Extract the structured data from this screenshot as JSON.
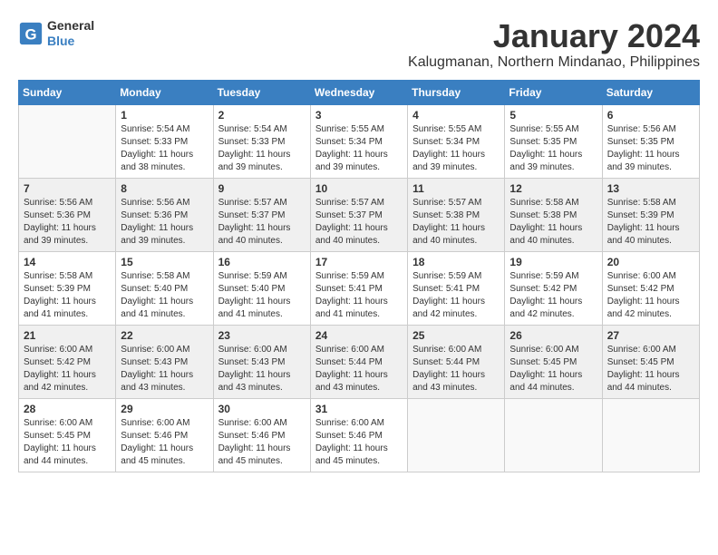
{
  "logo": {
    "general": "General",
    "blue": "Blue"
  },
  "header": {
    "title": "January 2024",
    "subtitle": "Kalugmanan, Northern Mindanao, Philippines"
  },
  "days_of_week": [
    "Sunday",
    "Monday",
    "Tuesday",
    "Wednesday",
    "Thursday",
    "Friday",
    "Saturday"
  ],
  "weeks": [
    [
      {
        "num": "",
        "empty": true
      },
      {
        "num": "1",
        "sunrise": "Sunrise: 5:54 AM",
        "sunset": "Sunset: 5:33 PM",
        "daylight": "Daylight: 11 hours and 38 minutes."
      },
      {
        "num": "2",
        "sunrise": "Sunrise: 5:54 AM",
        "sunset": "Sunset: 5:33 PM",
        "daylight": "Daylight: 11 hours and 39 minutes."
      },
      {
        "num": "3",
        "sunrise": "Sunrise: 5:55 AM",
        "sunset": "Sunset: 5:34 PM",
        "daylight": "Daylight: 11 hours and 39 minutes."
      },
      {
        "num": "4",
        "sunrise": "Sunrise: 5:55 AM",
        "sunset": "Sunset: 5:34 PM",
        "daylight": "Daylight: 11 hours and 39 minutes."
      },
      {
        "num": "5",
        "sunrise": "Sunrise: 5:55 AM",
        "sunset": "Sunset: 5:35 PM",
        "daylight": "Daylight: 11 hours and 39 minutes."
      },
      {
        "num": "6",
        "sunrise": "Sunrise: 5:56 AM",
        "sunset": "Sunset: 5:35 PM",
        "daylight": "Daylight: 11 hours and 39 minutes."
      }
    ],
    [
      {
        "num": "7",
        "sunrise": "Sunrise: 5:56 AM",
        "sunset": "Sunset: 5:36 PM",
        "daylight": "Daylight: 11 hours and 39 minutes."
      },
      {
        "num": "8",
        "sunrise": "Sunrise: 5:56 AM",
        "sunset": "Sunset: 5:36 PM",
        "daylight": "Daylight: 11 hours and 39 minutes."
      },
      {
        "num": "9",
        "sunrise": "Sunrise: 5:57 AM",
        "sunset": "Sunset: 5:37 PM",
        "daylight": "Daylight: 11 hours and 40 minutes."
      },
      {
        "num": "10",
        "sunrise": "Sunrise: 5:57 AM",
        "sunset": "Sunset: 5:37 PM",
        "daylight": "Daylight: 11 hours and 40 minutes."
      },
      {
        "num": "11",
        "sunrise": "Sunrise: 5:57 AM",
        "sunset": "Sunset: 5:38 PM",
        "daylight": "Daylight: 11 hours and 40 minutes."
      },
      {
        "num": "12",
        "sunrise": "Sunrise: 5:58 AM",
        "sunset": "Sunset: 5:38 PM",
        "daylight": "Daylight: 11 hours and 40 minutes."
      },
      {
        "num": "13",
        "sunrise": "Sunrise: 5:58 AM",
        "sunset": "Sunset: 5:39 PM",
        "daylight": "Daylight: 11 hours and 40 minutes."
      }
    ],
    [
      {
        "num": "14",
        "sunrise": "Sunrise: 5:58 AM",
        "sunset": "Sunset: 5:39 PM",
        "daylight": "Daylight: 11 hours and 41 minutes."
      },
      {
        "num": "15",
        "sunrise": "Sunrise: 5:58 AM",
        "sunset": "Sunset: 5:40 PM",
        "daylight": "Daylight: 11 hours and 41 minutes."
      },
      {
        "num": "16",
        "sunrise": "Sunrise: 5:59 AM",
        "sunset": "Sunset: 5:40 PM",
        "daylight": "Daylight: 11 hours and 41 minutes."
      },
      {
        "num": "17",
        "sunrise": "Sunrise: 5:59 AM",
        "sunset": "Sunset: 5:41 PM",
        "daylight": "Daylight: 11 hours and 41 minutes."
      },
      {
        "num": "18",
        "sunrise": "Sunrise: 5:59 AM",
        "sunset": "Sunset: 5:41 PM",
        "daylight": "Daylight: 11 hours and 42 minutes."
      },
      {
        "num": "19",
        "sunrise": "Sunrise: 5:59 AM",
        "sunset": "Sunset: 5:42 PM",
        "daylight": "Daylight: 11 hours and 42 minutes."
      },
      {
        "num": "20",
        "sunrise": "Sunrise: 6:00 AM",
        "sunset": "Sunset: 5:42 PM",
        "daylight": "Daylight: 11 hours and 42 minutes."
      }
    ],
    [
      {
        "num": "21",
        "sunrise": "Sunrise: 6:00 AM",
        "sunset": "Sunset: 5:42 PM",
        "daylight": "Daylight: 11 hours and 42 minutes."
      },
      {
        "num": "22",
        "sunrise": "Sunrise: 6:00 AM",
        "sunset": "Sunset: 5:43 PM",
        "daylight": "Daylight: 11 hours and 43 minutes."
      },
      {
        "num": "23",
        "sunrise": "Sunrise: 6:00 AM",
        "sunset": "Sunset: 5:43 PM",
        "daylight": "Daylight: 11 hours and 43 minutes."
      },
      {
        "num": "24",
        "sunrise": "Sunrise: 6:00 AM",
        "sunset": "Sunset: 5:44 PM",
        "daylight": "Daylight: 11 hours and 43 minutes."
      },
      {
        "num": "25",
        "sunrise": "Sunrise: 6:00 AM",
        "sunset": "Sunset: 5:44 PM",
        "daylight": "Daylight: 11 hours and 43 minutes."
      },
      {
        "num": "26",
        "sunrise": "Sunrise: 6:00 AM",
        "sunset": "Sunset: 5:45 PM",
        "daylight": "Daylight: 11 hours and 44 minutes."
      },
      {
        "num": "27",
        "sunrise": "Sunrise: 6:00 AM",
        "sunset": "Sunset: 5:45 PM",
        "daylight": "Daylight: 11 hours and 44 minutes."
      }
    ],
    [
      {
        "num": "28",
        "sunrise": "Sunrise: 6:00 AM",
        "sunset": "Sunset: 5:45 PM",
        "daylight": "Daylight: 11 hours and 44 minutes."
      },
      {
        "num": "29",
        "sunrise": "Sunrise: 6:00 AM",
        "sunset": "Sunset: 5:46 PM",
        "daylight": "Daylight: 11 hours and 45 minutes."
      },
      {
        "num": "30",
        "sunrise": "Sunrise: 6:00 AM",
        "sunset": "Sunset: 5:46 PM",
        "daylight": "Daylight: 11 hours and 45 minutes."
      },
      {
        "num": "31",
        "sunrise": "Sunrise: 6:00 AM",
        "sunset": "Sunset: 5:46 PM",
        "daylight": "Daylight: 11 hours and 45 minutes."
      },
      {
        "num": "",
        "empty": true
      },
      {
        "num": "",
        "empty": true
      },
      {
        "num": "",
        "empty": true
      }
    ]
  ]
}
